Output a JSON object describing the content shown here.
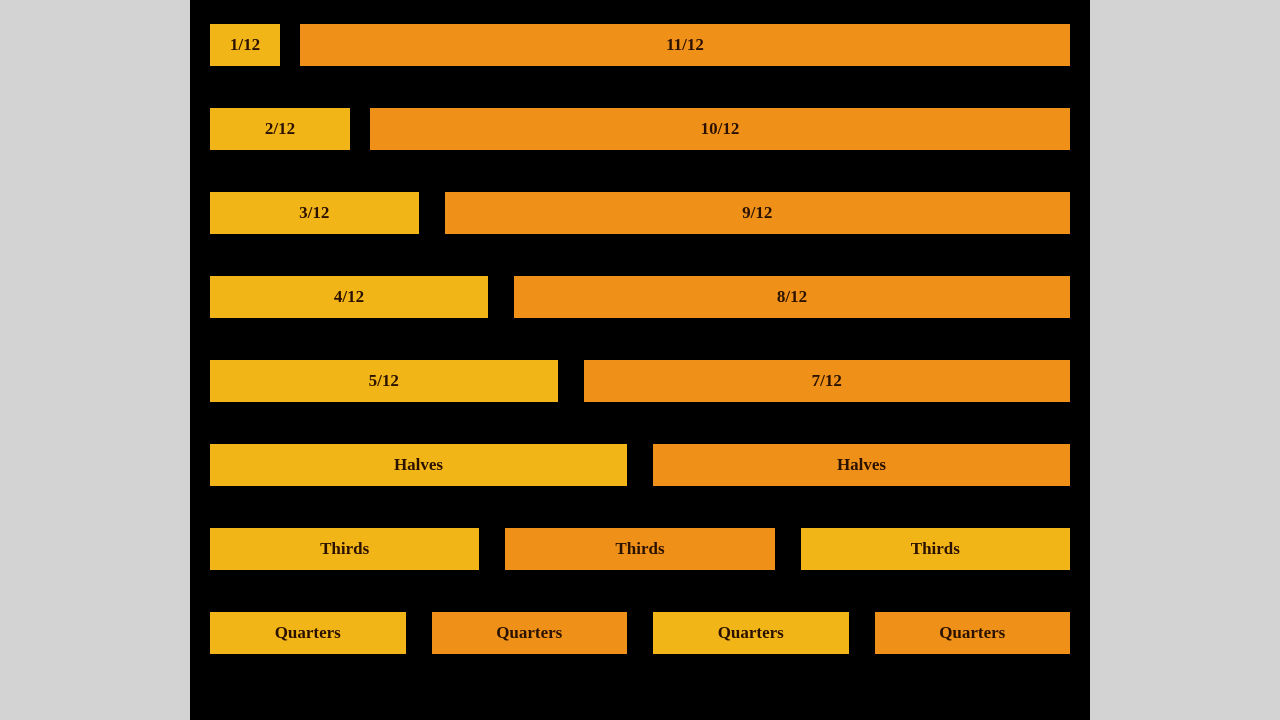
{
  "rows": [
    {
      "gap": 20,
      "bars": [
        {
          "label": "1/12",
          "flex": 1,
          "color": "c1"
        },
        {
          "label": "11/12",
          "flex": 11,
          "color": "c2"
        }
      ]
    },
    {
      "gap": 20,
      "bars": [
        {
          "label": "2/12",
          "flex": 2,
          "color": "c1"
        },
        {
          "label": "10/12",
          "flex": 10,
          "color": "c2"
        }
      ]
    },
    {
      "gap": 26,
      "bars": [
        {
          "label": "3/12",
          "flex": 3,
          "color": "c1"
        },
        {
          "label": "9/12",
          "flex": 9,
          "color": "c2"
        }
      ]
    },
    {
      "gap": 26,
      "bars": [
        {
          "label": "4/12",
          "flex": 4,
          "color": "c1"
        },
        {
          "label": "8/12",
          "flex": 8,
          "color": "c2"
        }
      ]
    },
    {
      "gap": 26,
      "bars": [
        {
          "label": "5/12",
          "flex": 5,
          "color": "c1"
        },
        {
          "label": "7/12",
          "flex": 7,
          "color": "c2"
        }
      ]
    },
    {
      "gap": 26,
      "bars": [
        {
          "label": "Halves",
          "flex": 1,
          "color": "c1"
        },
        {
          "label": "Halves",
          "flex": 1,
          "color": "c2"
        }
      ]
    },
    {
      "gap": 26,
      "bars": [
        {
          "label": "Thirds",
          "flex": 1,
          "color": "c1"
        },
        {
          "label": "Thirds",
          "flex": 1,
          "color": "c2"
        },
        {
          "label": "Thirds",
          "flex": 1,
          "color": "c1"
        }
      ]
    },
    {
      "gap": 26,
      "bars": [
        {
          "label": "Quarters",
          "flex": 1,
          "color": "c1"
        },
        {
          "label": "Quarters",
          "flex": 1,
          "color": "c2"
        },
        {
          "label": "Quarters",
          "flex": 1,
          "color": "c1"
        },
        {
          "label": "Quarters",
          "flex": 1,
          "color": "c2"
        }
      ]
    }
  ]
}
